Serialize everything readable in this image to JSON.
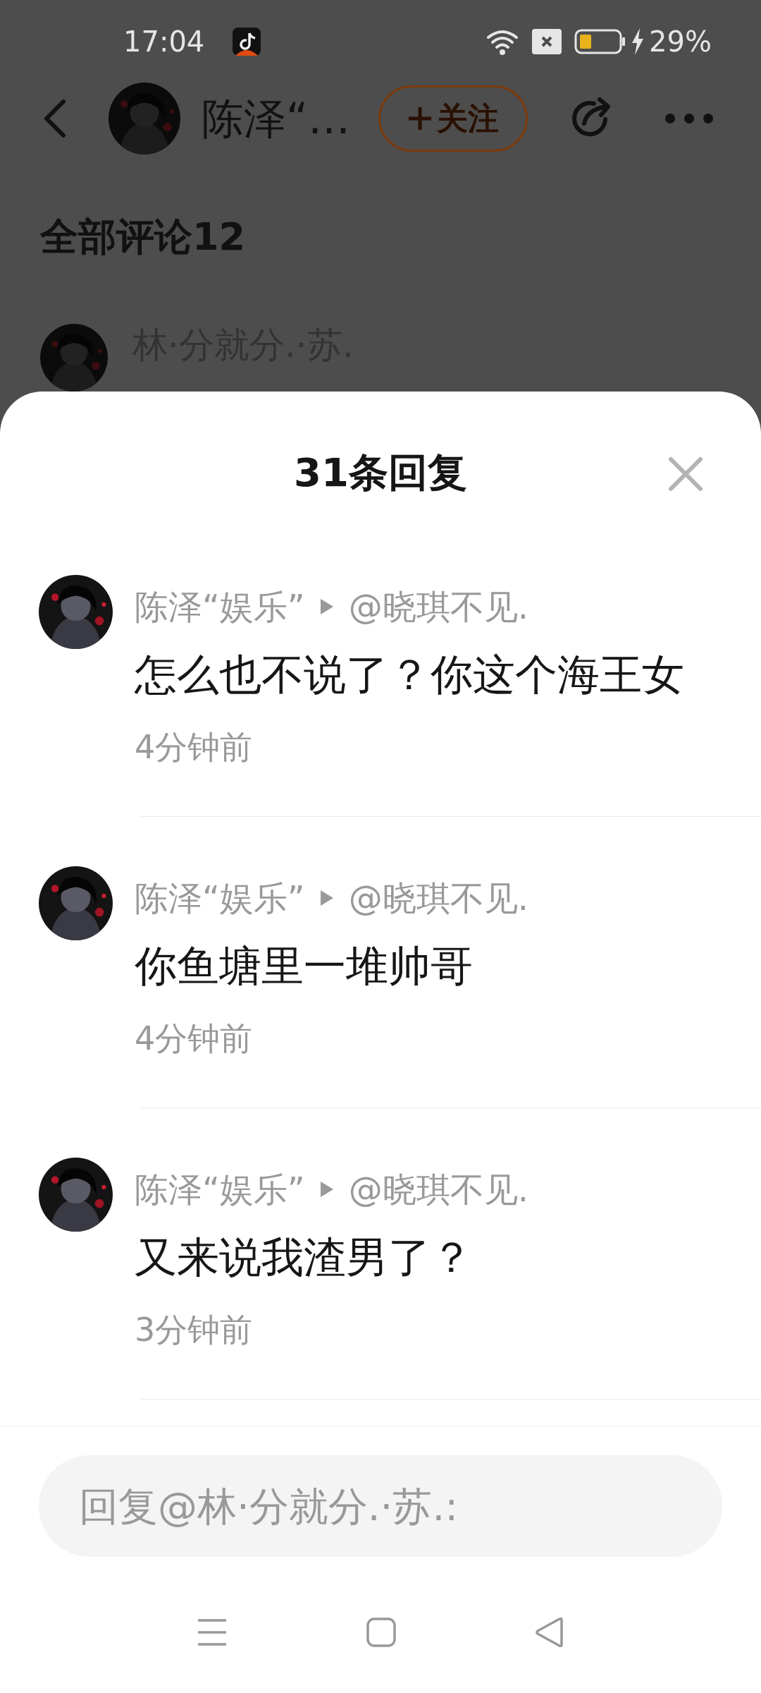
{
  "status_bar": {
    "time": "17:04",
    "battery": "29%"
  },
  "header": {
    "title": "陈泽“…",
    "follow_button": "关注"
  },
  "comments_page": {
    "heading": "全部评论12",
    "first_comment_author": "林·分就分.·苏."
  },
  "reply_sheet": {
    "title": "31条回复",
    "replies": [
      {
        "author": "陈泽“娱乐”",
        "reply_to": "@晓琪不见.",
        "text": "怎么也不说了？你这个海王女",
        "time": "4分钟前"
      },
      {
        "author": "陈泽“娱乐”",
        "reply_to": "@晓琪不见.",
        "text": "你鱼塘里一堆帅哥",
        "time": "4分钟前"
      },
      {
        "author": "陈泽“娱乐”",
        "reply_to": "@晓琪不见.",
        "text": "又来说我渣男了？",
        "time": "3分钟前"
      }
    ]
  },
  "reply_input": {
    "placeholder": "回复@林·分就分.·苏.:"
  }
}
